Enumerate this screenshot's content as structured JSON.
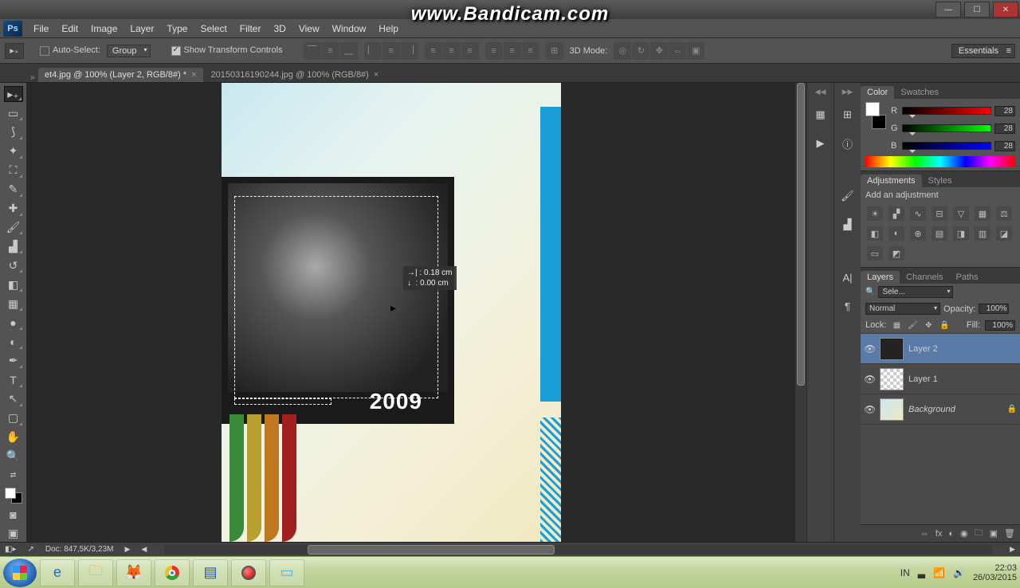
{
  "watermark": "www.Bandicam.com",
  "menu": [
    "File",
    "Edit",
    "Image",
    "Layer",
    "Type",
    "Select",
    "Filter",
    "3D",
    "View",
    "Window",
    "Help"
  ],
  "optbar": {
    "autoSelect": "Auto-Select:",
    "group": "Group",
    "showTransform": "Show Transform Controls",
    "mode3d": "3D Mode:",
    "workspace": "Essentials"
  },
  "tabs": [
    {
      "label": "et4.jpg @ 100% (Layer 2, RGB/8#) *"
    },
    {
      "label": "20150316190244.jpg @ 100% (RGB/8#)"
    }
  ],
  "tooltip": {
    "dx": "0.18 cm",
    "dy": "0.00 cm"
  },
  "photoYear": "2009",
  "status": {
    "doc": "Doc: 847,5K/3,23M"
  },
  "panels": {
    "colorTab": "Color",
    "swatchesTab": "Swatches",
    "r": "R",
    "g": "G",
    "b": "B",
    "rv": "28",
    "gv": "28",
    "bv": "28",
    "adjTab": "Adjustments",
    "stylesTab": "Styles",
    "adjLabel": "Add an adjustment",
    "layersTab": "Layers",
    "channelsTab": "Channels",
    "pathsTab": "Paths",
    "kind": "Sele...",
    "blend": "Normal",
    "opacityLab": "Opacity:",
    "opacity": "100%",
    "lockLab": "Lock:",
    "fillLab": "Fill:",
    "fill": "100%",
    "layers": [
      {
        "name": "Layer 2"
      },
      {
        "name": "Layer 1"
      },
      {
        "name": "Background"
      }
    ]
  },
  "tray": {
    "lang": "IN",
    "time": "22:03",
    "date": "26/03/2015"
  }
}
